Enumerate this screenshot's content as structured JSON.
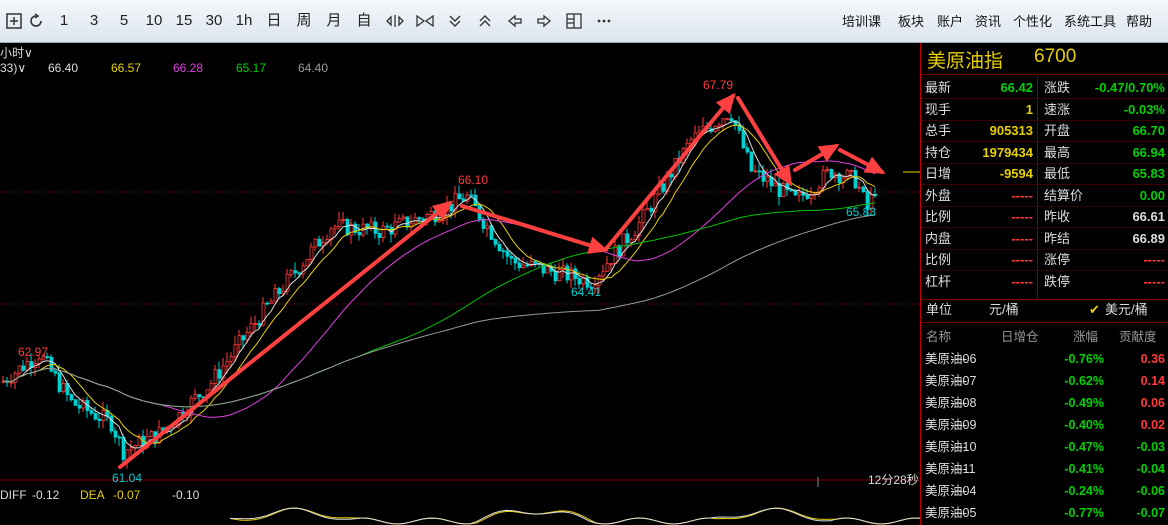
{
  "toolbar": {
    "buttons": [
      "1",
      "3",
      "5",
      "10",
      "15",
      "30",
      "1h",
      "日",
      "周",
      "月",
      "自"
    ],
    "menu": [
      "培训课",
      "板块",
      "账户",
      "资讯",
      "个性化",
      "系统工具",
      "帮助"
    ]
  },
  "chart": {
    "period": "小时∨",
    "ma_prefix": "33)∨",
    "ma_values": [
      "66.40",
      "66.57",
      "66.28",
      "65.17",
      "64.40"
    ],
    "price_labels": {
      "high": "67.79",
      "peak2": "66.10",
      "low2": "64.41",
      "last_low": "65.83",
      "left_high": "62.97",
      "low": "61.04"
    },
    "timer": "12分28秒",
    "macd": {
      "diff_label": "DIFF",
      "diff": "-0.12",
      "dea_label": "DEA",
      "dea": "-0.07",
      "macd": "-0.10"
    }
  },
  "colors": {
    "ma1": "#dddddd",
    "ma2": "#e8d000",
    "ma3": "#e040e0",
    "ma4": "#00c000",
    "ma5": "#9a9a9a",
    "up": "#ff3a3a",
    "down": "#00d0d0",
    "arrow": "#ff4040",
    "border": "#c00000"
  },
  "panel": {
    "title": "美原油指",
    "code": "6700",
    "left": [
      {
        "label": "最新",
        "value": "66.42"
      },
      {
        "label": "现手",
        "value": "1"
      },
      {
        "label": "总手",
        "value": "905313"
      },
      {
        "label": "持仓",
        "value": "1979434"
      },
      {
        "label": "日增",
        "value": "-9594"
      },
      {
        "label": "外盘",
        "value": "-----"
      },
      {
        "label": "比例",
        "value": "-----"
      },
      {
        "label": "内盘",
        "value": "-----"
      },
      {
        "label": "比例",
        "value": "-----"
      },
      {
        "label": "杠杆",
        "value": "-----"
      }
    ],
    "right": [
      {
        "label": "涨跌",
        "value": "-0.47/0.70%"
      },
      {
        "label": "速涨",
        "value": "-0.03%"
      },
      {
        "label": "开盘",
        "value": "66.70"
      },
      {
        "label": "最高",
        "value": "66.94"
      },
      {
        "label": "最低",
        "value": "65.83"
      },
      {
        "label": "结算价",
        "value": "0.00"
      },
      {
        "label": "昨收",
        "value": "66.61"
      },
      {
        "label": "昨结",
        "value": "66.89"
      },
      {
        "label": "涨停",
        "value": "-----"
      },
      {
        "label": "跌停",
        "value": "-----"
      }
    ],
    "unit_label": "单位",
    "unit_a": "元/桶",
    "unit_b": "美元/桶",
    "check": "✔",
    "contract_headers": [
      "名称",
      "日增仓",
      "涨幅",
      "贡献度"
    ],
    "contracts": [
      {
        "name": "美原油06",
        "inc": "----",
        "chg": "-0.76%",
        "contrib": "0.36"
      },
      {
        "name": "美原油07",
        "inc": "----",
        "chg": "-0.62%",
        "contrib": "0.14"
      },
      {
        "name": "美原油08",
        "inc": "----",
        "chg": "-0.49%",
        "contrib": "0.06"
      },
      {
        "name": "美原油09",
        "inc": "----",
        "chg": "-0.40%",
        "contrib": "0.02"
      },
      {
        "name": "美原油10",
        "inc": "----",
        "chg": "-0.47%",
        "contrib": "-0.03"
      },
      {
        "name": "美原油11",
        "inc": "----",
        "chg": "-0.41%",
        "contrib": "-0.04"
      },
      {
        "name": "美原油04",
        "inc": "----",
        "chg": "-0.24%",
        "contrib": "-0.06"
      },
      {
        "name": "美原油05",
        "inc": "----",
        "chg": "-0.77%",
        "contrib": "-0.07"
      }
    ]
  }
}
